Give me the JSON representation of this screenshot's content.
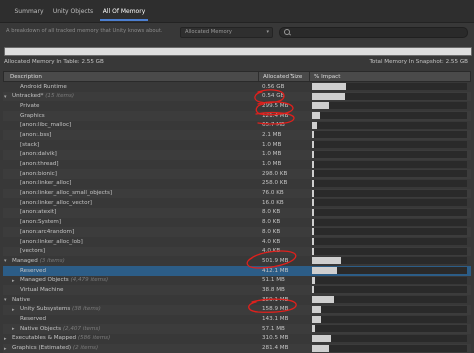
{
  "tabs": [
    {
      "label": "Summary",
      "active": false
    },
    {
      "label": "Unity Objects",
      "active": false
    },
    {
      "label": "All Of Memory",
      "active": true
    }
  ],
  "toolbar": {
    "description": "A breakdown of all tracked memory that Unity knows about.",
    "dropdown_value": "Allocated Memory",
    "search_placeholder": ""
  },
  "summary": {
    "table_total": "Allocated Memory In Table: 2.55 GB",
    "snapshot_total": "Total Memory In Snapshot: 2.55 GB"
  },
  "columns": {
    "description": "Description",
    "allocated_size": "Allocated Size",
    "impact": "% Impact"
  },
  "rows": [
    {
      "name": "Android Runtime",
      "size": "0.56 GB",
      "impact": 0.22,
      "level": 1,
      "foldout": "",
      "count": "",
      "selected": false
    },
    {
      "name": "Untracked*",
      "size": "0.54 GB",
      "impact": 0.21,
      "level": 0,
      "foldout": "expanded",
      "count": "(15 items)",
      "selected": false
    },
    {
      "name": "Private",
      "size": "299.5 MB",
      "impact": 0.11,
      "level": 1,
      "foldout": "",
      "count": "",
      "selected": false
    },
    {
      "name": "Graphics",
      "size": "121.4 MB",
      "impact": 0.05,
      "level": 1,
      "foldout": "",
      "count": "",
      "selected": false
    },
    {
      "name": "[anon:libc_malloc]",
      "size": "65.7 MB",
      "impact": 0.03,
      "level": 1,
      "foldout": "",
      "count": "",
      "selected": false
    },
    {
      "name": "[anon:.bss]",
      "size": "2.1 MB",
      "impact": 0.004,
      "level": 1,
      "foldout": "",
      "count": "",
      "selected": false
    },
    {
      "name": "[stack]",
      "size": "1.0 MB",
      "impact": 0.003,
      "level": 1,
      "foldout": "",
      "count": "",
      "selected": false
    },
    {
      "name": "[anon:dalvik]",
      "size": "1.0 MB",
      "impact": 0.003,
      "level": 1,
      "foldout": "",
      "count": "",
      "selected": false
    },
    {
      "name": "[anon:thread]",
      "size": "1.0 MB",
      "impact": 0.003,
      "level": 1,
      "foldout": "",
      "count": "",
      "selected": false
    },
    {
      "name": "[anon:bionic]",
      "size": "298.0 KB",
      "impact": 0.002,
      "level": 1,
      "foldout": "",
      "count": "",
      "selected": false
    },
    {
      "name": "[anon:linker_alloc]",
      "size": "258.0 KB",
      "impact": 0.002,
      "level": 1,
      "foldout": "",
      "count": "",
      "selected": false
    },
    {
      "name": "[anon:linker_alloc_small_objects]",
      "size": "76.0 KB",
      "impact": 0.001,
      "level": 1,
      "foldout": "",
      "count": "",
      "selected": false
    },
    {
      "name": "[anon:linker_alloc_vector]",
      "size": "16.0 KB",
      "impact": 0.001,
      "level": 1,
      "foldout": "",
      "count": "",
      "selected": false
    },
    {
      "name": "[anon:atexit]",
      "size": "8.0 KB",
      "impact": 0.001,
      "level": 1,
      "foldout": "",
      "count": "",
      "selected": false
    },
    {
      "name": "[anon:System]",
      "size": "8.0 KB",
      "impact": 0.001,
      "level": 1,
      "foldout": "",
      "count": "",
      "selected": false
    },
    {
      "name": "[anon:arc4random]",
      "size": "8.0 KB",
      "impact": 0.001,
      "level": 1,
      "foldout": "",
      "count": "",
      "selected": false
    },
    {
      "name": "[anon:linker_alloc_lob]",
      "size": "4.0 KB",
      "impact": 0.001,
      "level": 1,
      "foldout": "",
      "count": "",
      "selected": false
    },
    {
      "name": "[vectors]",
      "size": "4.0 KB",
      "impact": 0.001,
      "level": 1,
      "foldout": "",
      "count": "",
      "selected": false
    },
    {
      "name": "Managed",
      "size": "501.9 MB",
      "impact": 0.19,
      "level": 0,
      "foldout": "expanded",
      "count": "(3 items)",
      "selected": false
    },
    {
      "name": "Reserved",
      "size": "412.1 MB",
      "impact": 0.16,
      "level": 1,
      "foldout": "",
      "count": "",
      "selected": true
    },
    {
      "name": "Managed Objects",
      "size": "51.1 MB",
      "impact": 0.02,
      "level": 1,
      "foldout": "collapsed",
      "count": "(4,479 items)",
      "selected": false
    },
    {
      "name": "Virtual Machine",
      "size": "38.8 MB",
      "impact": 0.015,
      "level": 1,
      "foldout": "",
      "count": "",
      "selected": false
    },
    {
      "name": "Native",
      "size": "359.1 MB",
      "impact": 0.14,
      "level": 0,
      "foldout": "expanded",
      "count": "",
      "selected": false
    },
    {
      "name": "Unity Subsystems",
      "size": "158.9 MB",
      "impact": 0.06,
      "level": 1,
      "foldout": "collapsed",
      "count": "(38 items)",
      "selected": false
    },
    {
      "name": "Reserved",
      "size": "143.1 MB",
      "impact": 0.055,
      "level": 1,
      "foldout": "",
      "count": "",
      "selected": false
    },
    {
      "name": "Native Objects",
      "size": "57.1 MB",
      "impact": 0.022,
      "level": 1,
      "foldout": "collapsed",
      "count": "(2,407 items)",
      "selected": false
    },
    {
      "name": "Executables & Mapped",
      "size": "310.5 MB",
      "impact": 0.12,
      "level": 0,
      "foldout": "collapsed",
      "count": "(586 items)",
      "selected": false
    },
    {
      "name": "Graphics (Estimated)",
      "size": "281.4 MB",
      "impact": 0.11,
      "level": 0,
      "foldout": "collapsed",
      "count": "(2 items)",
      "selected": false
    }
  ],
  "colors": {
    "background": "#383838",
    "accent": "#4c7fd1",
    "selected_row": "#2c5d87",
    "annotation": "#e0201c"
  }
}
